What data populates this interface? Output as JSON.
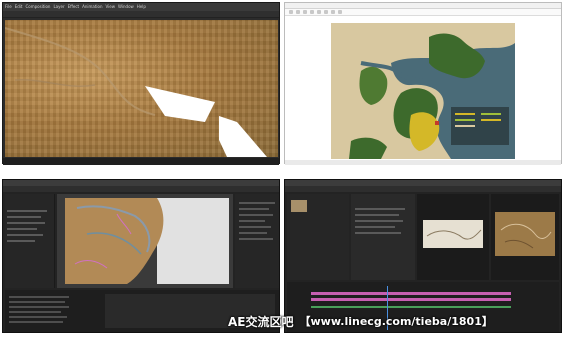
{
  "watermark": {
    "title": "AE交流区吧",
    "url": "【www.linecg.com/tieba/1801】"
  },
  "top_left": {
    "menu": [
      "File",
      "Edit",
      "Composition",
      "Layer",
      "Effect",
      "Animation",
      "View",
      "Window",
      "Help"
    ]
  },
  "colors": {
    "dark_ui": "#232323",
    "map_sea": "#4a6b78",
    "map_land": "#d8c8a0",
    "map_green": "#3d6a2c",
    "map_yellow": "#d4b828",
    "timeline_pink": "#c65fb1"
  }
}
